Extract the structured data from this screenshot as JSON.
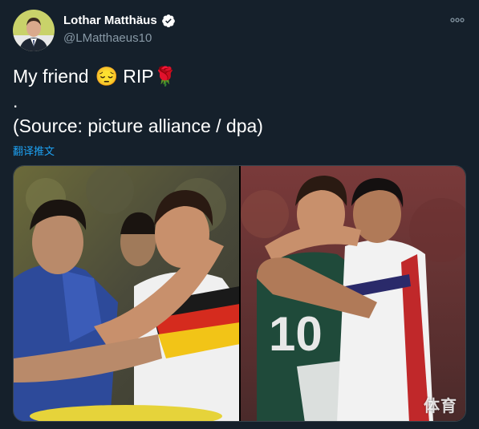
{
  "author": {
    "display_name": "Lothar Matthäus",
    "handle": "@LMatthaeus10",
    "verified": true,
    "avatar": "user-avatar-photo"
  },
  "tweet": {
    "lines": [
      {
        "before": "My friend",
        "emoji": "😔",
        "after": "RIP",
        "emoji2": "🌹"
      },
      {
        "text": "."
      },
      {
        "text": "(Source: picture alliance / dpa)"
      }
    ],
    "translate_label": "翻译推文"
  },
  "media": {
    "photos": [
      "photo-left-embrace",
      "photo-right-embrace"
    ],
    "watermark": "体育",
    "jersey_number": "10"
  },
  "icons": {
    "more": "more-options-icon",
    "verified": "verified-badge-icon"
  },
  "colors": {
    "background": "#15202b",
    "secondary_text": "#8899a6",
    "link": "#1da1f2",
    "verified": "#ffffff"
  }
}
